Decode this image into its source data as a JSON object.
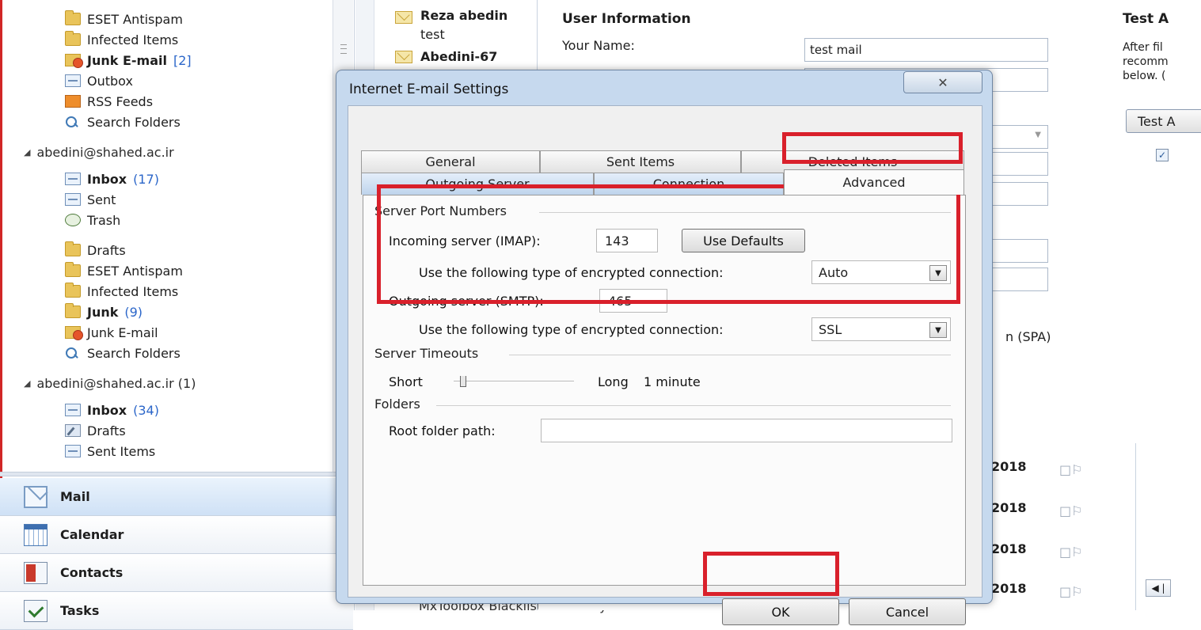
{
  "nav": {
    "folders_top": [
      {
        "label": "ESET Antispam",
        "icon": "folder-icon"
      },
      {
        "label": "Infected Items",
        "icon": "folder-icon"
      },
      {
        "label": "Junk E-mail",
        "count": "[2]",
        "icon": "junk-folder-icon"
      },
      {
        "label": "Outbox",
        "icon": "outbox-icon"
      },
      {
        "label": "RSS Feeds",
        "icon": "rss-icon"
      },
      {
        "label": "Search Folders",
        "icon": "search-folder-icon"
      }
    ],
    "account1": {
      "name": "abedini@shahed.ac.ir",
      "folders": [
        {
          "label": "Inbox",
          "count": "(17)"
        },
        {
          "label": "Sent"
        },
        {
          "label": "Trash"
        },
        {
          "label": "Drafts"
        },
        {
          "label": "ESET Antispam"
        },
        {
          "label": "Infected Items"
        },
        {
          "label": "Junk",
          "count": "(9)"
        },
        {
          "label": "Junk E-mail"
        },
        {
          "label": "Search Folders"
        }
      ]
    },
    "account2": {
      "name": "abedini@shahed.ac.ir (1)",
      "folders": [
        {
          "label": "Inbox",
          "count": "(34)"
        },
        {
          "label": "Drafts"
        },
        {
          "label": "Sent Items"
        }
      ]
    },
    "buttons": {
      "mail": "Mail",
      "calendar": "Calendar",
      "contacts": "Contacts",
      "tasks": "Tasks"
    }
  },
  "messages": [
    {
      "from": "Reza abedin",
      "subject": "test"
    },
    {
      "from": "Abedini-67"
    }
  ],
  "message_footer": "MxToolbox Blacklist Summary",
  "account_settings": {
    "section_title": "User Information",
    "your_name_label": "Your Name:",
    "your_name_value": "test mail",
    "test_title": "Test A",
    "test_text_1": "After fil",
    "test_text_2": "recomm",
    "test_text_3": "below. (",
    "test_button": "Test A",
    "spa_text": "n (SPA)"
  },
  "list_years": [
    "2018",
    "2018",
    "2018",
    "2018"
  ],
  "dialog": {
    "title": "Internet E-mail Settings",
    "close": "✕",
    "tabs_row1": [
      "General",
      "Sent Items",
      "Deleted Items"
    ],
    "tabs_row2": [
      "Outgoing Server",
      "Connection",
      "Advanced"
    ],
    "active_tab": "Advanced",
    "port_group": "Server Port Numbers",
    "incoming_label": "Incoming server (IMAP):",
    "incoming_value": "143",
    "use_defaults": "Use Defaults",
    "enc_label": "Use the following type of encrypted connection:",
    "incoming_enc": "Auto",
    "outgoing_label": "Outgoing server (SMTP):",
    "outgoing_value": "465",
    "outgoing_enc": "SSL",
    "timeouts_group": "Server Timeouts",
    "short_label": "Short",
    "long_label": "Long",
    "timeout_value": "1 minute",
    "timeout_level": 0.05,
    "folders_group": "Folders",
    "root_label": "Root folder path:",
    "root_value": "",
    "ok": "OK",
    "cancel": "Cancel"
  },
  "colors": {
    "highlight": "#d9202b",
    "dialog_frame": "#c6d9ee",
    "count_blue": "#2b66c9"
  }
}
